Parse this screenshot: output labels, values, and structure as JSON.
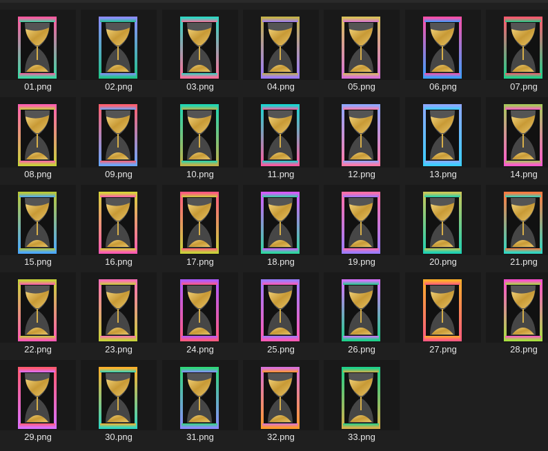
{
  "files": [
    {
      "name": "01.png",
      "c1": "#ff5aa0",
      "c2": "#3ad9a4"
    },
    {
      "name": "02.png",
      "c1": "#8c8cff",
      "c2": "#22c48a"
    },
    {
      "name": "03.png",
      "c1": "#2fd7c3",
      "c2": "#ff6f9a"
    },
    {
      "name": "04.png",
      "c1": "#c4b24a",
      "c2": "#9c7cff"
    },
    {
      "name": "05.png",
      "c1": "#d8c15a",
      "c2": "#d872d8"
    },
    {
      "name": "06.png",
      "c1": "#ff4fa8",
      "c2": "#3aa0ff"
    },
    {
      "name": "07.png",
      "c1": "#ff5a6e",
      "c2": "#1ed18a"
    },
    {
      "name": "08.png",
      "c1": "#ff60b0",
      "c2": "#c8d23a"
    },
    {
      "name": "09.png",
      "c1": "#ff5f6e",
      "c2": "#6aa8ff"
    },
    {
      "name": "10.png",
      "c1": "#1ed6b4",
      "c2": "#c2b24a"
    },
    {
      "name": "11.png",
      "c1": "#19d6d0",
      "c2": "#ff5aa0"
    },
    {
      "name": "12.png",
      "c1": "#8fa8ff",
      "c2": "#ff7aa8"
    },
    {
      "name": "13.png",
      "c1": "#8fa8ff",
      "c2": "#3ad0ff"
    },
    {
      "name": "14.png",
      "c1": "#a7c85a",
      "c2": "#ff5ad0"
    },
    {
      "name": "15.png",
      "c1": "#b8c83a",
      "c2": "#4aa8ff"
    },
    {
      "name": "16.png",
      "c1": "#d8d23a",
      "c2": "#ff5ab4"
    },
    {
      "name": "17.png",
      "c1": "#ff5a80",
      "c2": "#c8d23a"
    },
    {
      "name": "18.png",
      "c1": "#d85aff",
      "c2": "#2fd7a0"
    },
    {
      "name": "19.png",
      "c1": "#ff6fa8",
      "c2": "#9c7cff"
    },
    {
      "name": "20.png",
      "c1": "#c8c85a",
      "c2": "#1ed1b4"
    },
    {
      "name": "21.png",
      "c1": "#ff7a40",
      "c2": "#2fd7c3"
    },
    {
      "name": "22.png",
      "c1": "#c8d23a",
      "c2": "#ff5ab4"
    },
    {
      "name": "23.png",
      "c1": "#ff6fb8",
      "c2": "#c8d23a"
    },
    {
      "name": "24.png",
      "c1": "#b05aff",
      "c2": "#ff5a80"
    },
    {
      "name": "25.png",
      "c1": "#9c7cff",
      "c2": "#ff5ab4"
    },
    {
      "name": "26.png",
      "c1": "#d872ff",
      "c2": "#1ed18a"
    },
    {
      "name": "27.png",
      "c1": "#ffb02a",
      "c2": "#ff5a80"
    },
    {
      "name": "28.png",
      "c1": "#ff4fd0",
      "c2": "#a8e040"
    },
    {
      "name": "29.png",
      "c1": "#ff5a6e",
      "c2": "#d872ff"
    },
    {
      "name": "30.png",
      "c1": "#ffb02a",
      "c2": "#2fd7c3"
    },
    {
      "name": "31.png",
      "c1": "#2fd77a",
      "c2": "#8c8cff"
    },
    {
      "name": "32.png",
      "c1": "#d872d8",
      "c2": "#ff9a2a"
    },
    {
      "name": "33.png",
      "c1": "#1ed18a",
      "c2": "#d8b04a"
    }
  ]
}
